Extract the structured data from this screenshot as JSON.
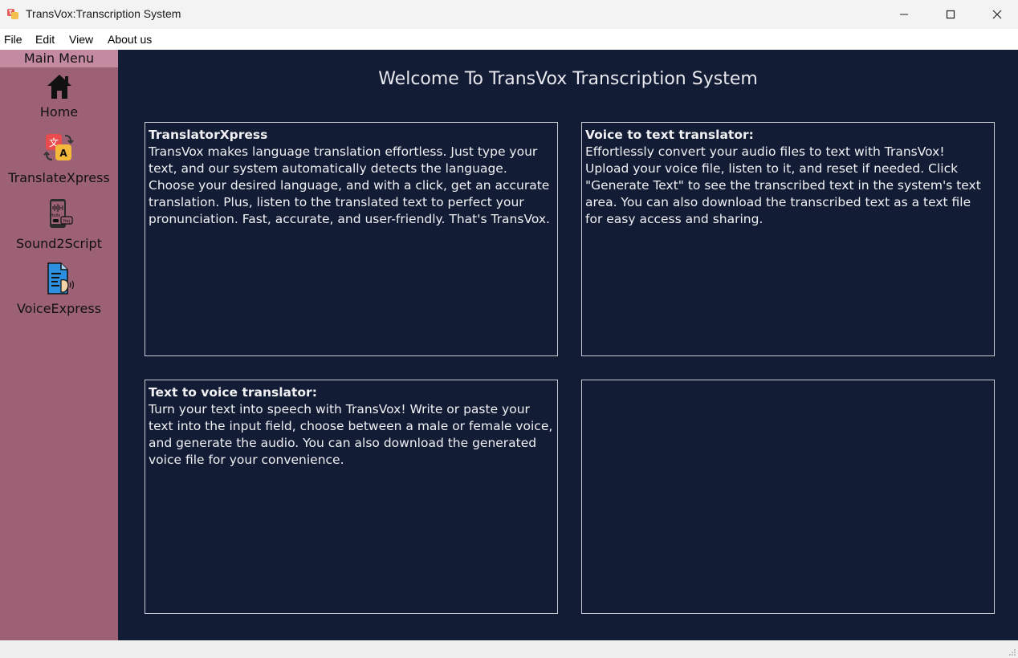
{
  "window": {
    "title": "TransVox:Transcription System"
  },
  "menubar": {
    "items": [
      "File",
      "Edit",
      "View",
      "About us"
    ]
  },
  "sidebar": {
    "header": "Main Menu",
    "items": [
      {
        "label": "Home",
        "icon": "home-icon"
      },
      {
        "label": "TranslateXpress",
        "icon": "translate-icon"
      },
      {
        "label": "Sound2Script",
        "icon": "phone-audio-icon"
      },
      {
        "label": "VoiceExpress",
        "icon": "document-voice-icon"
      }
    ]
  },
  "main": {
    "welcome": "Welcome To TransVox Transcription System",
    "cards": [
      {
        "title": "TranslatorXpress",
        "body": "TransVox makes language translation effortless. Just type your text, and our system automatically detects the language. Choose your desired language, and with a click, get an accurate translation. Plus, listen to the translated text to perfect your pronunciation. Fast, accurate, and user-friendly. That's TransVox."
      },
      {
        "title": "Voice to text translator:",
        "body": "Effortlessly convert your audio files to text with TransVox! Upload your voice file, listen to it, and reset if needed. Click \"Generate Text\" to see the transcribed text in the system's text area. You can also download the transcribed text as a text file for easy access and sharing."
      },
      {
        "title": "Text to voice translator:",
        "body": "Turn your text into speech with TransVox! Write or paste your text into the input field, choose between a male or female voice, and generate the audio. You can also download the generated voice file for your convenience."
      },
      {
        "title": "",
        "body": ""
      }
    ]
  },
  "colors": {
    "sidebar": "#9d6176",
    "sidebar_header": "#c48aa0",
    "main_bg": "#121c35",
    "card_border": "#c9ccd4"
  }
}
